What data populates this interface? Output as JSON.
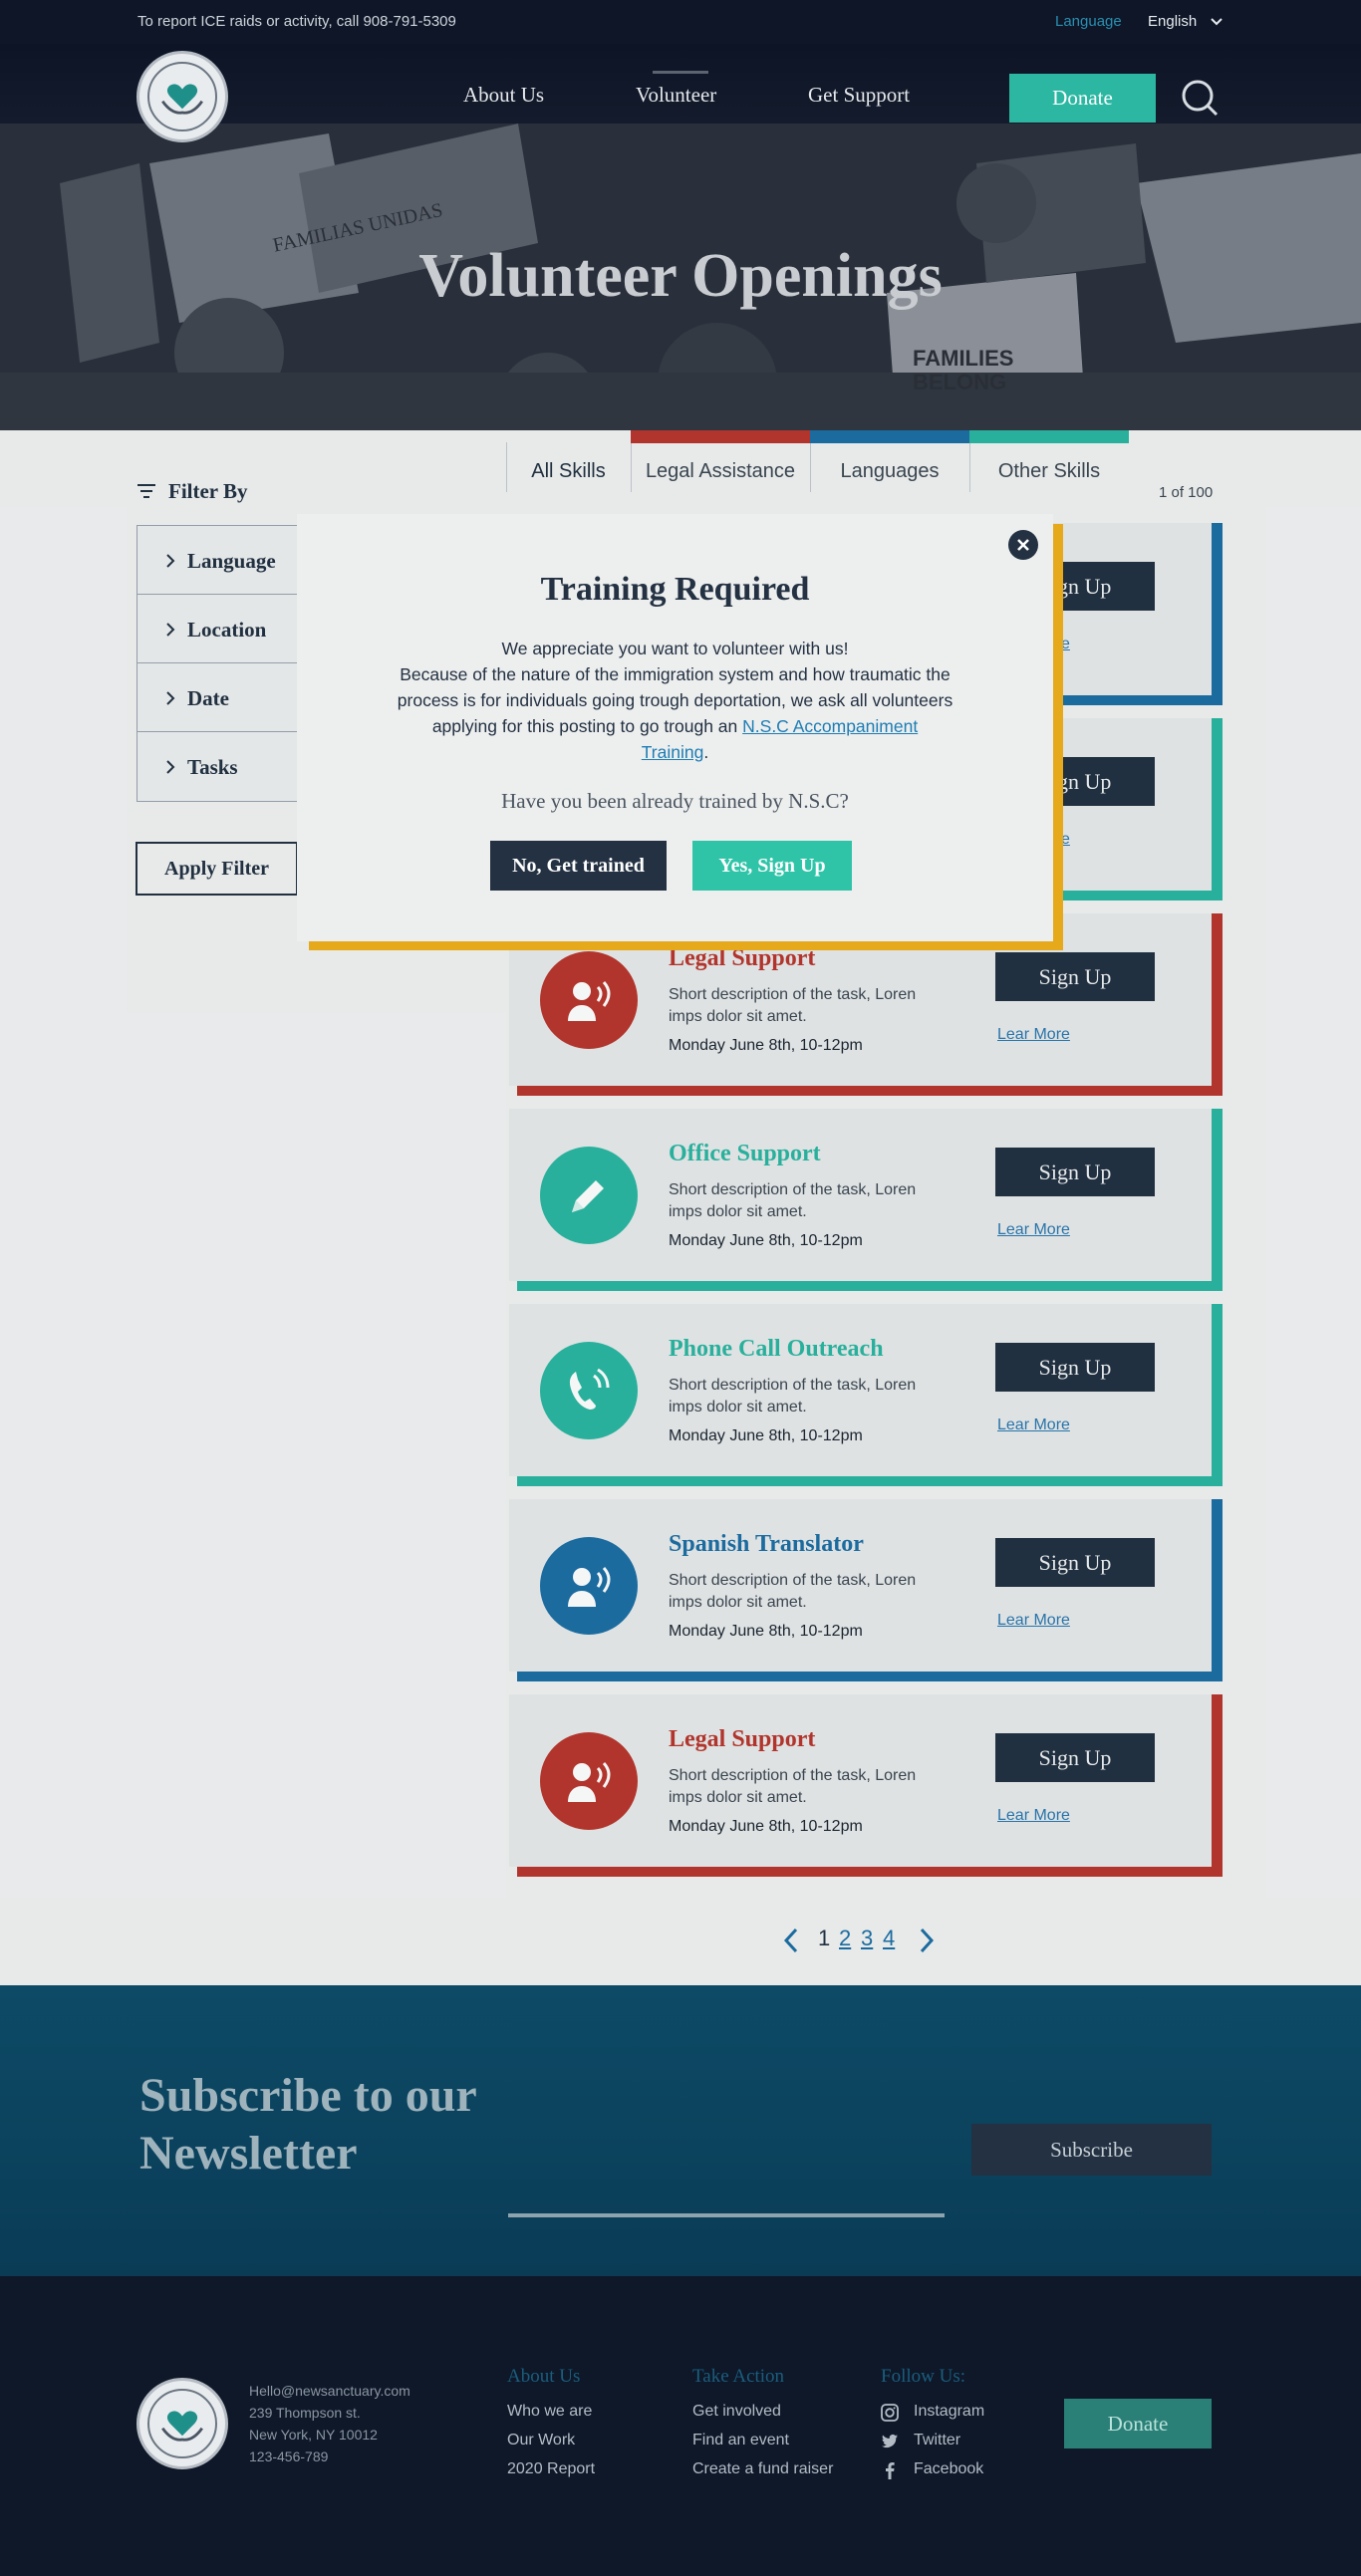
{
  "topbar": {
    "report": "To report ICE raids or activity, call 908-791-5309",
    "language_label": "Language",
    "language_value": "English"
  },
  "nav": {
    "about": "About Us",
    "volunteer": "Volunteer",
    "support": "Get Support",
    "donate": "Donate"
  },
  "hero": {
    "title": "Volunteer Openings",
    "signs": [
      "FAMILIAS UNIDAS",
      "FAMILIES BELONG"
    ]
  },
  "filter": {
    "title": "Filter By",
    "items": [
      "Language",
      "Location",
      "Date",
      "Tasks"
    ],
    "apply": "Apply Filter"
  },
  "tabs": {
    "items": [
      "All Skills",
      "Legal Assistance",
      "Languages",
      "Other Skills"
    ],
    "colors": [
      "",
      "#b9372d",
      "#1d6fa5",
      "#2bb7a2"
    ],
    "count": "1 of 100"
  },
  "cards": [
    {
      "title": "",
      "desc": "",
      "date": "",
      "signup": "Sign Up",
      "more": "Lear More",
      "color": "#1d6fa5",
      "icon": "speaker-icon"
    },
    {
      "title": "",
      "desc": "",
      "date": "",
      "signup": "Sign Up",
      "more": "Lear More",
      "color": "#2bb7a2",
      "icon": "speaker-icon"
    },
    {
      "title": "Legal Support",
      "desc": "Short description of the task,  Loren imps dolor sit amet.",
      "date": "Monday June 8th, 10-12pm",
      "signup": "Sign Up",
      "more": "Lear More",
      "color": "#b9372d",
      "icon": "speaker-icon"
    },
    {
      "title": "Office Support",
      "desc": "Short description of the task,  Loren imps dolor sit amet.",
      "date": "Monday June 8th, 10-12pm",
      "signup": "Sign Up",
      "more": "Lear More",
      "color": "#2bb7a2",
      "icon": "pencil-icon"
    },
    {
      "title": "Phone Call Outreach",
      "desc": "Short description of the task,  Loren imps dolor sit amet.",
      "date": "Monday June 8th, 10-12pm",
      "signup": "Sign Up",
      "more": "Lear More",
      "color": "#2bb7a2",
      "icon": "phone-icon"
    },
    {
      "title": "Spanish Translator",
      "desc": "Short description of the task,  Loren imps dolor sit amet.",
      "date": "Monday June 8th, 10-12pm",
      "signup": "Sign Up",
      "more": "Lear More",
      "color": "#1d6fa5",
      "icon": "speaker-icon"
    },
    {
      "title": "Legal Support",
      "desc": "Short description of the task,  Loren imps dolor sit amet.",
      "date": "Monday June 8th, 10-12pm",
      "signup": "Sign Up",
      "more": "Lear More",
      "color": "#b9372d",
      "icon": "speaker-icon"
    }
  ],
  "pager": {
    "pages": [
      "1",
      "2",
      "3",
      "4"
    ],
    "current": 1
  },
  "newsletter": {
    "title": "Subscribe to our Newsletter",
    "button": "Subscribe"
  },
  "footer": {
    "contact": [
      "Hello@newsanctuary.com",
      "239 Thompson st.",
      "New York, NY 10012",
      "123-456-789"
    ],
    "columns": [
      {
        "head": "About Us",
        "links": [
          "Who we are",
          "Our Work",
          "2020 Report"
        ]
      },
      {
        "head": "Take Action",
        "links": [
          "Get involved",
          "Find an event",
          "Create a fund raiser"
        ]
      },
      {
        "head": "Follow Us:",
        "links": [
          "Instagram",
          "Twitter",
          "Facebook"
        ]
      }
    ],
    "donate": "Donate"
  },
  "modal": {
    "title": "Training Required",
    "line1": "We appreciate you want to volunteer with us!",
    "body": "Because of the nature of the immigration system and how traumatic the process is for individuals going trough deportation, we ask all volunteers applying for this posting to go trough an ",
    "link": "N.S.C Accompaniment Training",
    "after": ".",
    "question": "Have you been already trained by N.S.C?",
    "no": "No, Get trained",
    "yes": "Yes, Sign Up"
  }
}
